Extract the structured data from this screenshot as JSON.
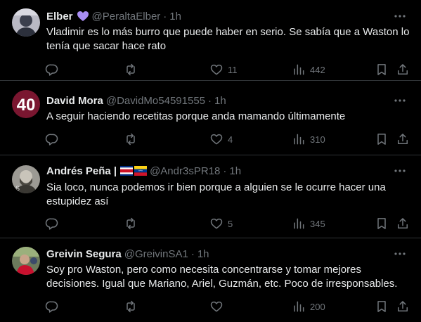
{
  "tweets": [
    {
      "name": "Elber",
      "badge": "purple-heart",
      "handle": "@PeraltaElber",
      "time": "1h",
      "text": "Vladimir es lo más burro que puede haber en serio. Se sabía que a Waston lo tenía que sacar hace rato",
      "replies": "",
      "reposts": "",
      "likes": "11",
      "views": "442"
    },
    {
      "name": "David Mora",
      "handle": "@DavidMo54591555",
      "time": "1h",
      "avatar_text": "40",
      "text": "A seguir haciendo recetitas porque anda mamando últimamente",
      "replies": "",
      "reposts": "",
      "likes": "4",
      "views": "310"
    },
    {
      "name": "Andrés Peña |",
      "badge": "flags-cr-ve",
      "handle": "@Andr3sPR18",
      "time": "1h",
      "text": "Sia loco, nunca podemos ir bien porque a alguien se le ocurre hacer una estupidez así",
      "replies": "",
      "reposts": "",
      "likes": "5",
      "views": "345"
    },
    {
      "name": "Greivin Segura",
      "handle": "@GreivinSA1",
      "time": "1h",
      "text": "Soy pro Waston, pero como necesita concentrarse y tomar mejores decisiones. Igual que Mariano, Ariel, Guzmán, etc. Poco de irresponsables.",
      "replies": "",
      "reposts": "",
      "likes": "",
      "views": "200"
    }
  ],
  "separator": "·",
  "icons": {
    "reply": "reply-icon",
    "repost": "repost-icon",
    "like": "heart-icon",
    "views": "views-chart-icon",
    "bookmark": "bookmark-icon",
    "share": "share-icon",
    "more": "more-icon"
  },
  "colors": {
    "background": "#000000",
    "text": "#e7e9ea",
    "secondary": "#71767b",
    "divider": "#2f3336",
    "heart_badge": "#a98ef4",
    "avatar_40": "#7a1630"
  }
}
